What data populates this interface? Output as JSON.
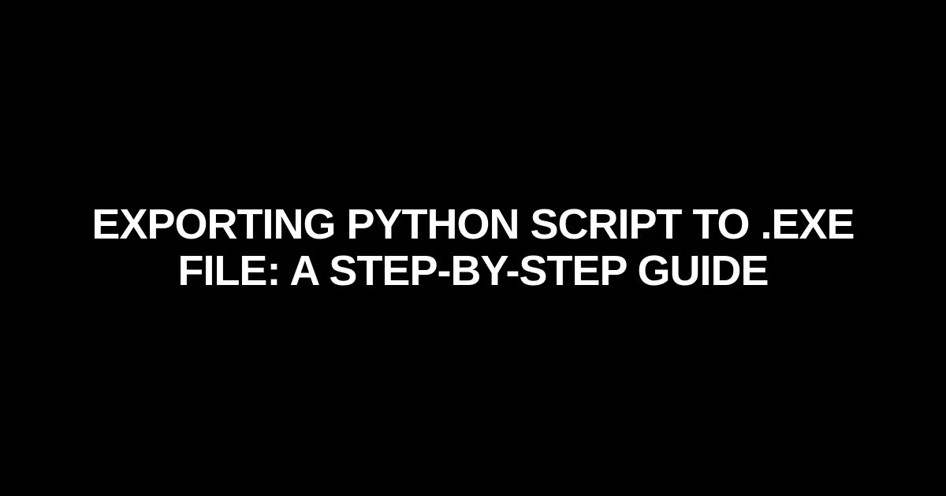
{
  "title": "Exporting Python Script to .exe File: A Step-by-Step Guide"
}
